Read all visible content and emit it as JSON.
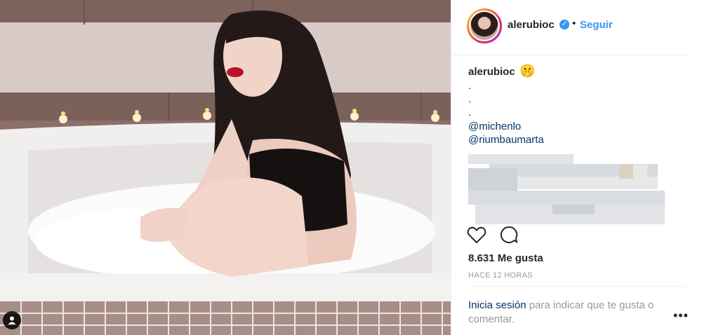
{
  "header": {
    "username": "alerubioc",
    "verified_icon": "verified-badge-icon",
    "separator": "•",
    "follow_label": "Seguir"
  },
  "caption": {
    "username": "alerubioc",
    "emoji": "🤫",
    "lines": [
      ".",
      ".",
      "."
    ],
    "mentions": [
      "@michenlo",
      "@riumbaumarta"
    ]
  },
  "actions": {
    "like_icon": "heart-icon",
    "comment_icon": "comment-icon"
  },
  "likes_text": "8.631 Me gusta",
  "timestamp": "HACE 12 HORAS",
  "login_prompt": {
    "link": "Inicia sesión",
    "text": " para indicar que te gusta o comentar."
  },
  "more_label": "•••",
  "colors": {
    "link_blue": "#3897f0",
    "mention_blue": "#003569",
    "text": "#262626",
    "muted": "#999999"
  }
}
